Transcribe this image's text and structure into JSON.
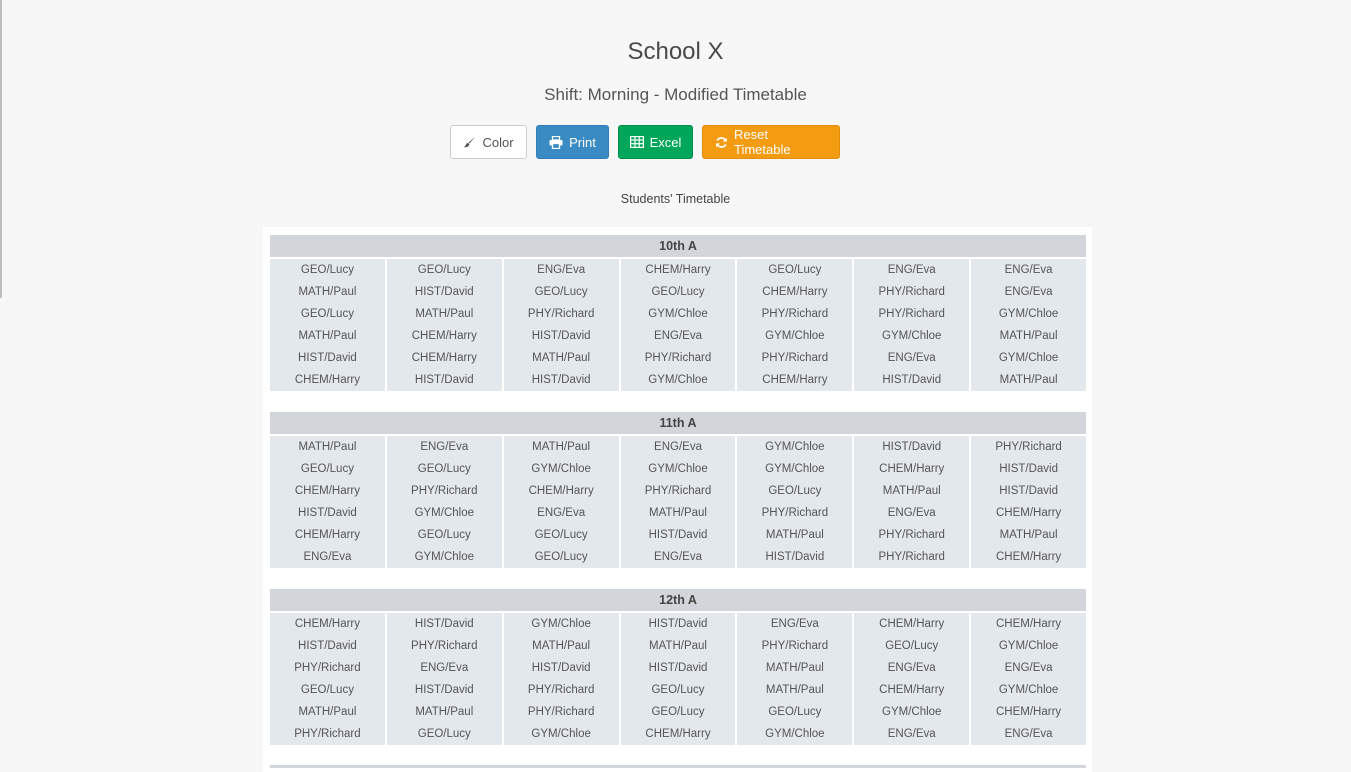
{
  "header": {
    "title": "School X",
    "subtitle": "Shift: Morning - Modified Timetable"
  },
  "toolbar": {
    "color_label": "Color",
    "print_label": "Print",
    "excel_label": "Excel",
    "reset_label": "Reset Timetable",
    "colors": {
      "print": "#3a8bc4",
      "excel": "#00a65a",
      "reset": "#f39c12"
    },
    "icons": {
      "color": "paintbrush-icon",
      "print": "printer-icon",
      "excel": "table-icon",
      "reset": "refresh-icon"
    }
  },
  "timetable": {
    "caption": "Students' Timetable",
    "classes": [
      {
        "name": "10th A",
        "columns": [
          [
            "GEO/Lucy",
            "MATH/Paul",
            "GEO/Lucy",
            "MATH/Paul",
            "HIST/David",
            "CHEM/Harry"
          ],
          [
            "GEO/Lucy",
            "HIST/David",
            "MATH/Paul",
            "CHEM/Harry",
            "CHEM/Harry",
            "HIST/David"
          ],
          [
            "ENG/Eva",
            "GEO/Lucy",
            "PHY/Richard",
            "HIST/David",
            "MATH/Paul",
            "HIST/David"
          ],
          [
            "CHEM/Harry",
            "GEO/Lucy",
            "GYM/Chloe",
            "ENG/Eva",
            "PHY/Richard",
            "GYM/Chloe"
          ],
          [
            "GEO/Lucy",
            "CHEM/Harry",
            "PHY/Richard",
            "GYM/Chloe",
            "PHY/Richard",
            "CHEM/Harry"
          ],
          [
            "ENG/Eva",
            "PHY/Richard",
            "PHY/Richard",
            "GYM/Chloe",
            "ENG/Eva",
            "HIST/David"
          ],
          [
            "ENG/Eva",
            "ENG/Eva",
            "GYM/Chloe",
            "MATH/Paul",
            "GYM/Chloe",
            "MATH/Paul"
          ]
        ]
      },
      {
        "name": "11th A",
        "columns": [
          [
            "MATH/Paul",
            "GEO/Lucy",
            "CHEM/Harry",
            "HIST/David",
            "CHEM/Harry",
            "ENG/Eva"
          ],
          [
            "ENG/Eva",
            "GEO/Lucy",
            "PHY/Richard",
            "GYM/Chloe",
            "GEO/Lucy",
            "GYM/Chloe"
          ],
          [
            "MATH/Paul",
            "GYM/Chloe",
            "CHEM/Harry",
            "ENG/Eva",
            "GEO/Lucy",
            "GEO/Lucy"
          ],
          [
            "ENG/Eva",
            "GYM/Chloe",
            "PHY/Richard",
            "MATH/Paul",
            "HIST/David",
            "ENG/Eva"
          ],
          [
            "GYM/Chloe",
            "GYM/Chloe",
            "GEO/Lucy",
            "PHY/Richard",
            "MATH/Paul",
            "HIST/David"
          ],
          [
            "HIST/David",
            "CHEM/Harry",
            "MATH/Paul",
            "ENG/Eva",
            "PHY/Richard",
            "PHY/Richard"
          ],
          [
            "PHY/Richard",
            "HIST/David",
            "HIST/David",
            "CHEM/Harry",
            "MATH/Paul",
            "CHEM/Harry"
          ]
        ]
      },
      {
        "name": "12th A",
        "columns": [
          [
            "CHEM/Harry",
            "HIST/David",
            "PHY/Richard",
            "GEO/Lucy",
            "MATH/Paul",
            "PHY/Richard"
          ],
          [
            "HIST/David",
            "PHY/Richard",
            "ENG/Eva",
            "HIST/David",
            "MATH/Paul",
            "GEO/Lucy"
          ],
          [
            "GYM/Chloe",
            "MATH/Paul",
            "HIST/David",
            "PHY/Richard",
            "PHY/Richard",
            "GYM/Chloe"
          ],
          [
            "HIST/David",
            "MATH/Paul",
            "HIST/David",
            "GEO/Lucy",
            "GEO/Lucy",
            "CHEM/Harry"
          ],
          [
            "ENG/Eva",
            "PHY/Richard",
            "MATH/Paul",
            "MATH/Paul",
            "GEO/Lucy",
            "GYM/Chloe"
          ],
          [
            "CHEM/Harry",
            "GEO/Lucy",
            "ENG/Eva",
            "CHEM/Harry",
            "GYM/Chloe",
            "ENG/Eva"
          ],
          [
            "CHEM/Harry",
            "GYM/Chloe",
            "ENG/Eva",
            "GYM/Chloe",
            "CHEM/Harry",
            "ENG/Eva"
          ]
        ]
      }
    ]
  }
}
